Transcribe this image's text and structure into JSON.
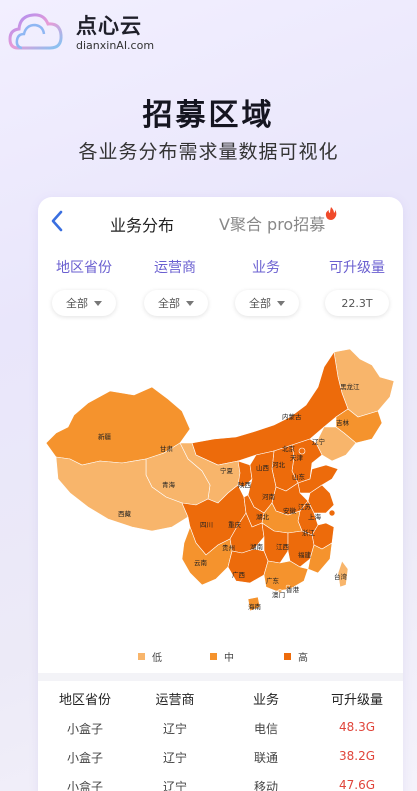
{
  "brand": {
    "name": "点心云",
    "domain": "dianxinAI.com"
  },
  "hero": {
    "title": "招募区域",
    "subtitle": "各业务分布需求量数据可视化"
  },
  "tabs": {
    "active": "业务分布",
    "other": "V聚合 pro招募"
  },
  "filters": {
    "labels": [
      "地区省份",
      "运营商",
      "业务",
      "可升级量"
    ],
    "values": [
      "全部",
      "全部",
      "全部",
      "22.3T"
    ]
  },
  "map": {
    "provinces": [
      "黑龙江",
      "内蒙古",
      "吉林",
      "辽宁",
      "北京",
      "天津",
      "新疆",
      "甘肃",
      "宁夏",
      "山西",
      "河北",
      "山东",
      "青海",
      "陕西",
      "河南",
      "江苏",
      "西藏",
      "安徽",
      "上海",
      "四川",
      "重庆",
      "湖北",
      "浙江",
      "贵州",
      "湖南",
      "江西",
      "福建",
      "云南",
      "广西",
      "广东",
      "台湾",
      "香港",
      "澳门",
      "海南"
    ]
  },
  "legend": {
    "low": "低",
    "mid": "中",
    "high": "高"
  },
  "colors": {
    "low": "#f8b56b",
    "mid": "#f5932d",
    "high": "#ed6b0b",
    "accent": "#6a5fd0",
    "value": "#e0443a"
  },
  "table": {
    "headers": [
      "地区省份",
      "运营商",
      "业务",
      "可升级量"
    ],
    "rows": [
      [
        "小盒子",
        "辽宁",
        "电信",
        "48.3G"
      ],
      [
        "小盒子",
        "辽宁",
        "联通",
        "38.2G"
      ],
      [
        "小盒子",
        "辽宁",
        "移动",
        "47.6G"
      ]
    ]
  }
}
